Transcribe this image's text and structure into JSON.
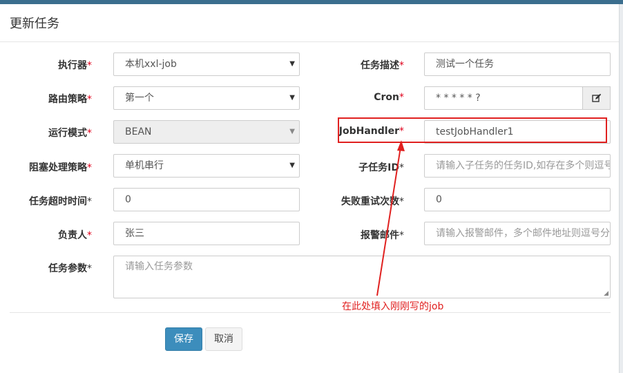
{
  "modal": {
    "title": "更新任务"
  },
  "required_mark": "*",
  "fields": {
    "executor": {
      "label": "执行器",
      "value": "本机xxl-job"
    },
    "task_desc": {
      "label": "任务描述",
      "value": "测试一个任务"
    },
    "route_strategy": {
      "label": "路由策略",
      "value": "第一个"
    },
    "cron": {
      "label": "Cron",
      "value": "* * * * * ?"
    },
    "run_mode": {
      "label": "运行模式",
      "value": "BEAN"
    },
    "job_handler": {
      "label": "JobHandler",
      "value": "testJobHandler1"
    },
    "block_strategy": {
      "label": "阻塞处理策略",
      "value": "单机串行"
    },
    "child_job_id": {
      "label": "子任务ID",
      "placeholder": "请输入子任务的任务ID,如存在多个则逗号分隔"
    },
    "timeout": {
      "label": "任务超时时间",
      "value": "0"
    },
    "fail_retry": {
      "label": "失败重试次数",
      "value": "0"
    },
    "author": {
      "label": "负责人",
      "value": "张三"
    },
    "alarm_email": {
      "label": "报警邮件",
      "placeholder": "请输入报警邮件，多个邮件地址则逗号分隔"
    },
    "params": {
      "label": "任务参数",
      "placeholder": "请输入任务参数"
    }
  },
  "buttons": {
    "save": "保存",
    "cancel": "取消"
  },
  "annotation": {
    "text": "在此处填入刚刚写的job"
  },
  "icons": {
    "cron_edit": "edit-icon",
    "select_arrow": "caret-down-icon"
  },
  "colors": {
    "primary": "#3c8dbc",
    "annotation": "#e0201f",
    "topbar": "#3b6e8e"
  }
}
